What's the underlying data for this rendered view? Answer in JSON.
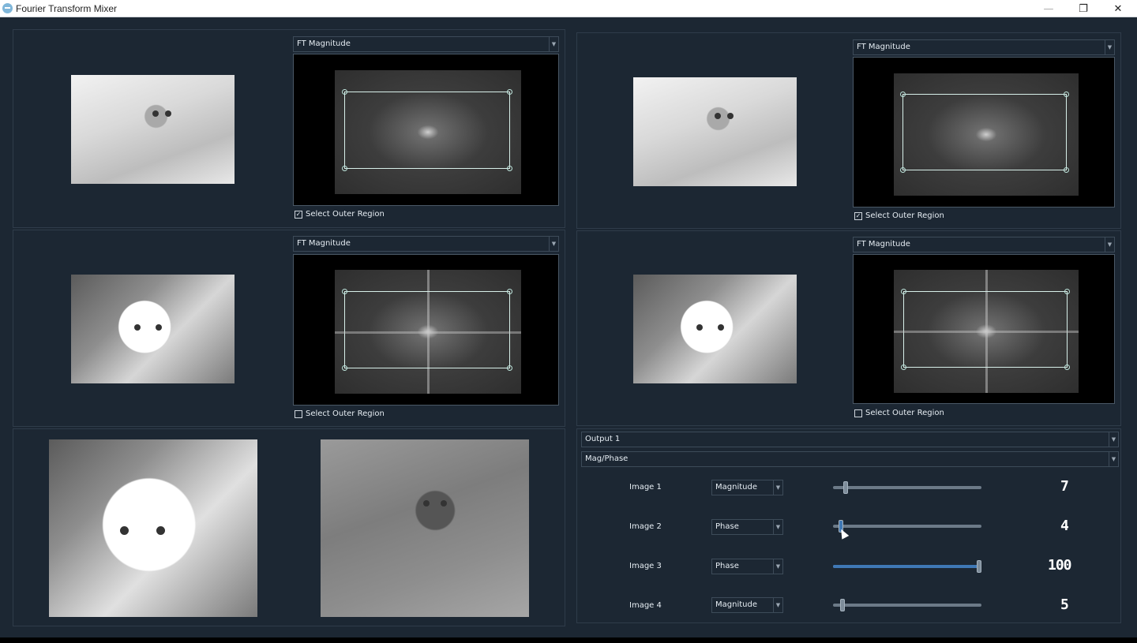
{
  "window": {
    "title": "Fourier Transform Mixer",
    "minimize": "—",
    "maximize": "❐",
    "close": "✕"
  },
  "viewers": [
    {
      "component": "FT Magnitude",
      "checkbox_label": "Select Outer Region",
      "outer_region_checked": true,
      "check_mark": "✓"
    },
    {
      "component": "FT Magnitude",
      "checkbox_label": "Select Outer Region",
      "outer_region_checked": true,
      "check_mark": "✓"
    },
    {
      "component": "FT Magnitude",
      "checkbox_label": "Select Outer Region",
      "outer_region_checked": false,
      "check_mark": ""
    },
    {
      "component": "FT Magnitude",
      "checkbox_label": "Select Outer Region",
      "outer_region_checked": false,
      "check_mark": ""
    }
  ],
  "mixer": {
    "output": "Output 1",
    "mode": "Mag/Phase",
    "rows": [
      {
        "label": "Image 1",
        "component": "Magnitude",
        "weight_display": "7",
        "slider_fraction": 0.07
      },
      {
        "label": "Image 2",
        "component": "Phase",
        "weight_display": "4",
        "slider_fraction": 0.04
      },
      {
        "label": "Image 3",
        "component": "Phase",
        "weight_display": "100",
        "slider_fraction": 1.0
      },
      {
        "label": "Image 4",
        "component": "Magnitude",
        "weight_display": "5",
        "slider_fraction": 0.05
      }
    ]
  },
  "colors": {
    "background": "#1c2733",
    "panel_border": "#2f3c4a",
    "slider_fill": "#3f78b5",
    "roi_outline": "#d8f0ea"
  },
  "icons": [
    "app-icon",
    "minimize-icon",
    "maximize-icon",
    "close-icon",
    "dropdown-arrow-icon",
    "checkbox-icon",
    "mouse-cursor-icon"
  ]
}
